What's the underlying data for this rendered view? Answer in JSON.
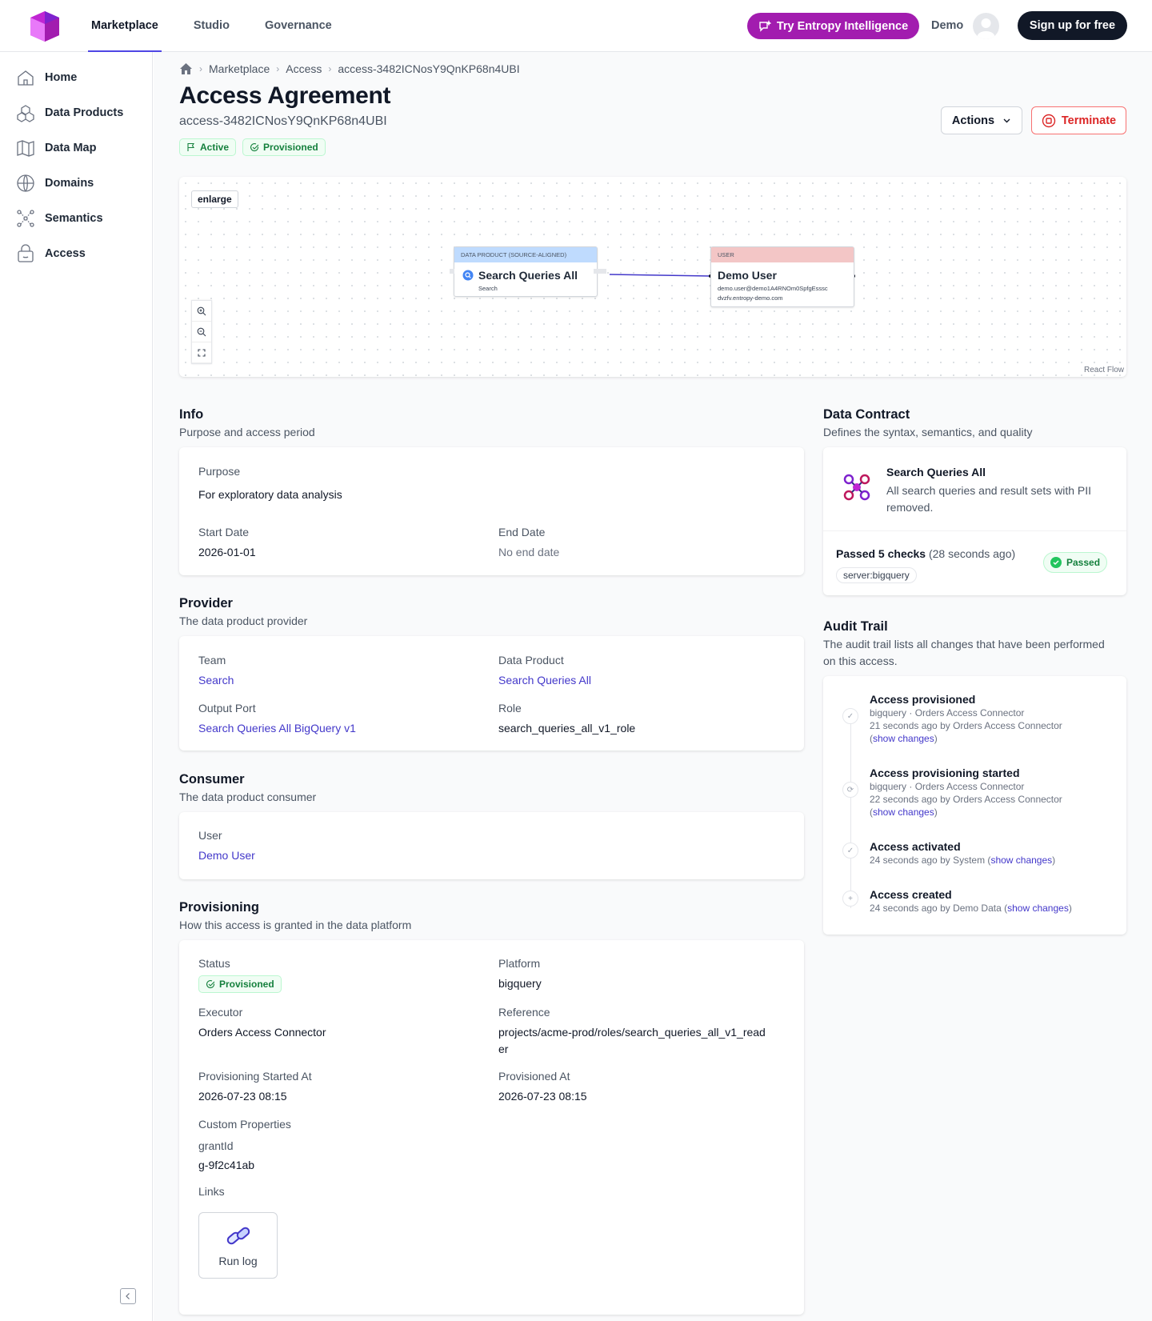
{
  "header": {
    "nav": [
      "Marketplace",
      "Studio",
      "Governance"
    ],
    "ai_button": "Try Entropy Intelligence",
    "user_label": "Demo",
    "signup": "Sign up for free"
  },
  "sidebar": {
    "items": [
      "Home",
      "Data Products",
      "Data Map",
      "Domains",
      "Semantics",
      "Access"
    ]
  },
  "breadcrumb": [
    "Marketplace",
    "Access",
    "access-3482ICNosY9QnKP68n4UBI"
  ],
  "page": {
    "title": "Access Agreement",
    "subtitle": "access-3482ICNosY9QnKP68n4UBI",
    "badges": [
      "Active",
      "Provisioned"
    ],
    "actions_label": "Actions",
    "terminate_label": "Terminate"
  },
  "flow": {
    "enlarge": "enlarge",
    "watermark": "React Flow",
    "product_node": {
      "type": "Data Product (Source-aligned)",
      "title": "Search Queries All",
      "sub": "Search"
    },
    "user_node": {
      "type": "User",
      "title": "Demo User",
      "email1": "demo.user@demo1A4RNOm0SpfgEsssc",
      "email2": "dvzfv.entropy-demo.com"
    }
  },
  "info": {
    "title": "Info",
    "desc": "Purpose and access period",
    "purpose_label": "Purpose",
    "purpose": "For exploratory data analysis",
    "start_label": "Start Date",
    "start": "2026-01-01",
    "end_label": "End Date",
    "end": "No end date"
  },
  "provider": {
    "title": "Provider",
    "desc": "The data product provider",
    "team_label": "Team",
    "team": "Search",
    "product_label": "Data Product",
    "product": "Search Queries All",
    "port_label": "Output Port",
    "port": "Search Queries All BigQuery v1",
    "role_label": "Role",
    "role": "search_queries_all_v1_role"
  },
  "consumer": {
    "title": "Consumer",
    "desc": "The data product consumer",
    "user_label": "User",
    "user": "Demo User"
  },
  "provisioning": {
    "title": "Provisioning",
    "desc": "How this access is granted in the data platform",
    "status_label": "Status",
    "status": "Provisioned",
    "platform_label": "Platform",
    "platform": "bigquery",
    "executor_label": "Executor",
    "executor": "Orders Access Connector",
    "reference_label": "Reference",
    "reference_1": "projects/acme-prod/roles/search_queries_all_v1_read",
    "reference_2": "er",
    "started_label": "Provisioning Started At",
    "started": "2026-07-23 08:15",
    "provisioned_label": "Provisioned At",
    "provisioned": "2026-07-23 08:15",
    "custom_label": "Custom Properties",
    "custom_key": "grantId",
    "custom_value": "g-9f2c41ab",
    "links_label": "Links",
    "link": "Run log"
  },
  "contract": {
    "title": "Data Contract",
    "desc": "Defines the syntax, semantics, and quality",
    "name": "Search Queries All",
    "text_1": "All search queries and result sets with PII",
    "text_2": "removed.",
    "checks_prefix": "Passed 5 checks",
    "checks_time": "(28 seconds ago)",
    "server": "server:bigquery",
    "status": "Passed"
  },
  "audit": {
    "title": "Audit Trail",
    "desc_1": "The audit trail lists all changes that have been performed",
    "desc_2": "on this access.",
    "show_changes": "show changes",
    "entries": [
      {
        "title": "Access provisioned",
        "meta": "bigquery · Orders Access Connector",
        "by": "21 seconds ago by Orders Access Connector"
      },
      {
        "title": "Access provisioning started",
        "meta": "bigquery · Orders Access Connector",
        "by": "22 seconds ago by Orders Access Connector"
      },
      {
        "title": "Access activated",
        "by": "24 seconds ago by System"
      },
      {
        "title": "Access created",
        "by": "24 seconds ago by Demo Data"
      }
    ]
  }
}
